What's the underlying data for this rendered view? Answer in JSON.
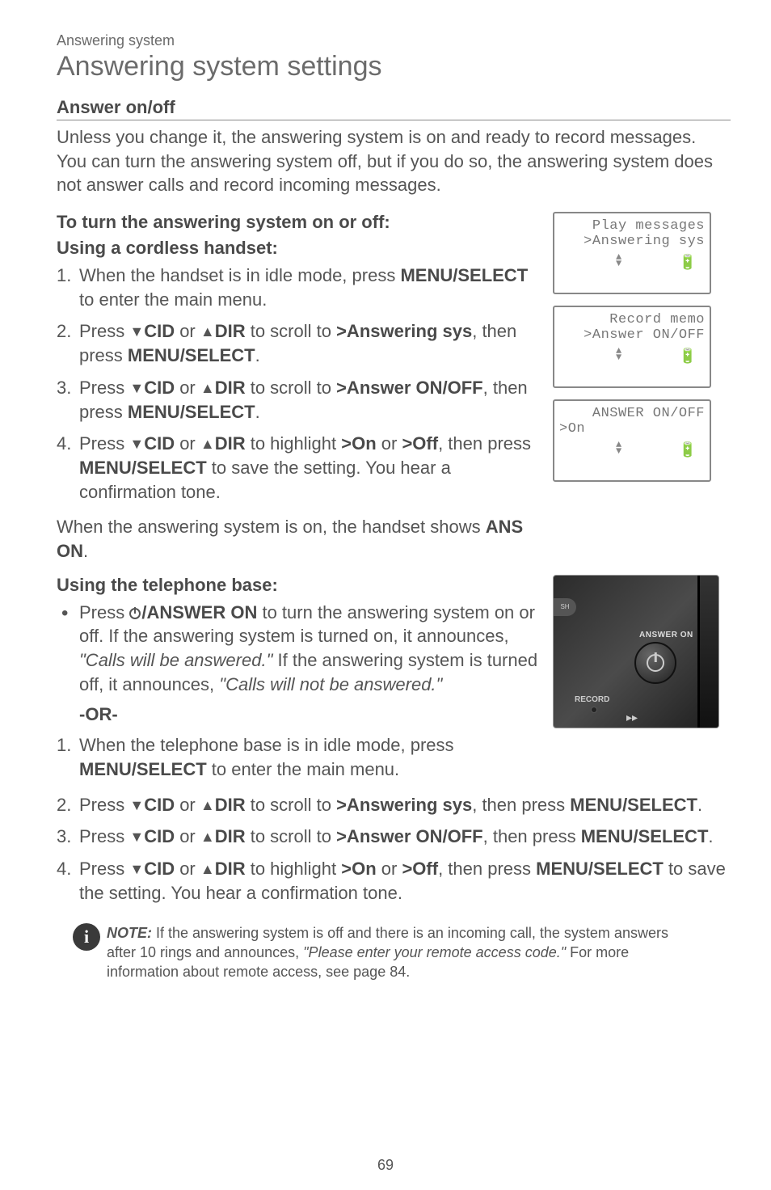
{
  "header": {
    "breadcrumb": "Answering system",
    "title": "Answering system settings"
  },
  "section": {
    "heading": "Answer on/off",
    "intro": "Unless you change it, the answering system is on and ready to record messages. You can turn the answering system off, but if you do so, the answering system does not answer calls and record incoming messages."
  },
  "handset": {
    "procHeading": "To turn the answering system on or off:",
    "sub": "Using a cordless handset:",
    "step1_a": "When the handset is in idle mode, press ",
    "step1_key": "MENU/SELECT",
    "step1_b": " to enter the main menu.",
    "step2_a": "Press ",
    "step2_cid": "CID",
    "step2_or": " or ",
    "step2_dir": "DIR",
    "step2_b": " to scroll to ",
    "step2_target": ">Answering sys",
    "step2_c": ", then press ",
    "step2_key": "MENU/SELECT",
    "step2_d": ".",
    "step3_a": "Press ",
    "step3_b": " to scroll to ",
    "step3_target": ">Answer ON/OFF",
    "step3_c": ", then press ",
    "step3_key": "MENU/SELECT",
    "step3_d": ".",
    "step4_a": "Press ",
    "step4_b": " to highlight ",
    "step4_on": ">On",
    "step4_or2": " or ",
    "step4_off": ">Off",
    "step4_c": ", then press ",
    "step4_key": "MENU/SELECT",
    "step4_d": " to save the setting. You hear a confirmation tone.",
    "result_a": "When the answering system is on, the handset shows ",
    "result_b": "ANS ON",
    "result_c": "."
  },
  "base": {
    "sub": "Using the telephone base:",
    "bullet_a": "Press ",
    "bullet_key": "/ANSWER ON",
    "bullet_b": " to turn the answering system on or off. If the answering system is turned on, it announces, ",
    "bullet_q1": "\"Calls will be answered.\"",
    "bullet_c": " If the answering system is turned off, it announces, ",
    "bullet_q2": "\"Calls will not be answered.\"",
    "or": "-OR-",
    "step1_a": "When the telephone base is in idle mode, press ",
    "step1_key": "MENU/SELECT",
    "step1_b": " to enter the main menu.",
    "step2_a": "Press ",
    "step2_b": " to scroll to ",
    "step2_target": ">Answering sys",
    "step2_c": ", then press ",
    "step2_key": "MENU/SELECT",
    "step2_d": ".",
    "step3_a": "Press ",
    "step3_b": " to scroll to ",
    "step3_target": ">Answer ON/OFF",
    "step3_c": ", then press ",
    "step3_key": "MENU/SELECT",
    "step3_d": ".",
    "step4_a": "Press ",
    "step4_b": " to highlight ",
    "step4_on": ">On",
    "step4_or2": " or ",
    "step4_off": ">Off",
    "step4_c": ", then press ",
    "step4_key": "MENU/SELECT",
    "step4_d": " to save the setting. You hear a confirmation tone."
  },
  "lcd": {
    "s1l1": " Play messages",
    "s1l2": ">Answering sys",
    "s2l1": " Record memo",
    "s2l2": ">Answer ON/OFF",
    "s3l1": " ANSWER ON/OFF",
    "s3l2": ">On"
  },
  "baseImg": {
    "answerOn": "ANSWER ON",
    "record": "RECORD",
    "tab": "SH"
  },
  "note": {
    "label": "NOTE:",
    "text_a": " If the answering system is off and there is an incoming call, the system answers after 10 rings and announces, ",
    "text_q": "\"Please enter your remote access code.\"",
    "text_b": " For more information about remote access, see page 84."
  },
  "pageNumber": "69",
  "glyph": {
    "down": "▼",
    "up": "▲",
    "battery": "🔋",
    "ff": "▸▸",
    "i": "i"
  }
}
